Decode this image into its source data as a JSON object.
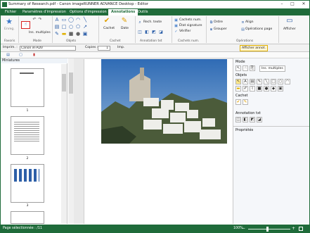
{
  "window": {
    "title": "Summary of Research.pdf - Canon imageRUNNER ADVANCE Desktop - Editor",
    "minimize": "–",
    "maximize": "□",
    "close": "✕"
  },
  "ribbon": {
    "tabs": [
      "Fichier",
      "Paramètres d'impression",
      "Options d'impression",
      "Annotations",
      "Outils"
    ],
    "groups": {
      "favoris": "Favoris",
      "mode": "Mode",
      "objets": "Objets",
      "cachet": "Cachet",
      "annotation_txt": "Annotation txt",
      "cachets_num": "Cachets num.",
      "operations": "Opérations"
    },
    "enreg": "Enreg.",
    "ins_multiples": "Ins. multiples",
    "cachet_label": "Cachet",
    "date_label": "Date",
    "rech_texte": "Rech. texte",
    "cachets_num_item": "Cachets num.",
    "etat_signature": "État signature",
    "verifier": "Vérifier",
    "ordre": "Ordre",
    "grouper": "Grouper",
    "align": "Align",
    "operations_page": "Opérations page",
    "afficher": "Afficher"
  },
  "toolbar": {
    "imprim_label": "Imprim. :",
    "printer": "Canon iR-ADV",
    "copies_label": "Copies :",
    "copies": "1",
    "imp_button": "Imp.",
    "afficher_annot": "Afficher annot."
  },
  "left": {
    "miniatures": "Miniatures",
    "pages": [
      "1",
      "2",
      "3"
    ]
  },
  "right": {
    "mode": "Mode",
    "ins_multiples": "Ins. multiples",
    "objets": "Objets",
    "cachet": "Cachet",
    "annotation_txt": "Annotation txt",
    "proprietes": "Propriétés"
  },
  "status": {
    "page": "Page sélectionnée : /11",
    "zoom": "100%"
  },
  "colors": {
    "accent": "#1f6b3a",
    "highlight": "#d92020"
  }
}
